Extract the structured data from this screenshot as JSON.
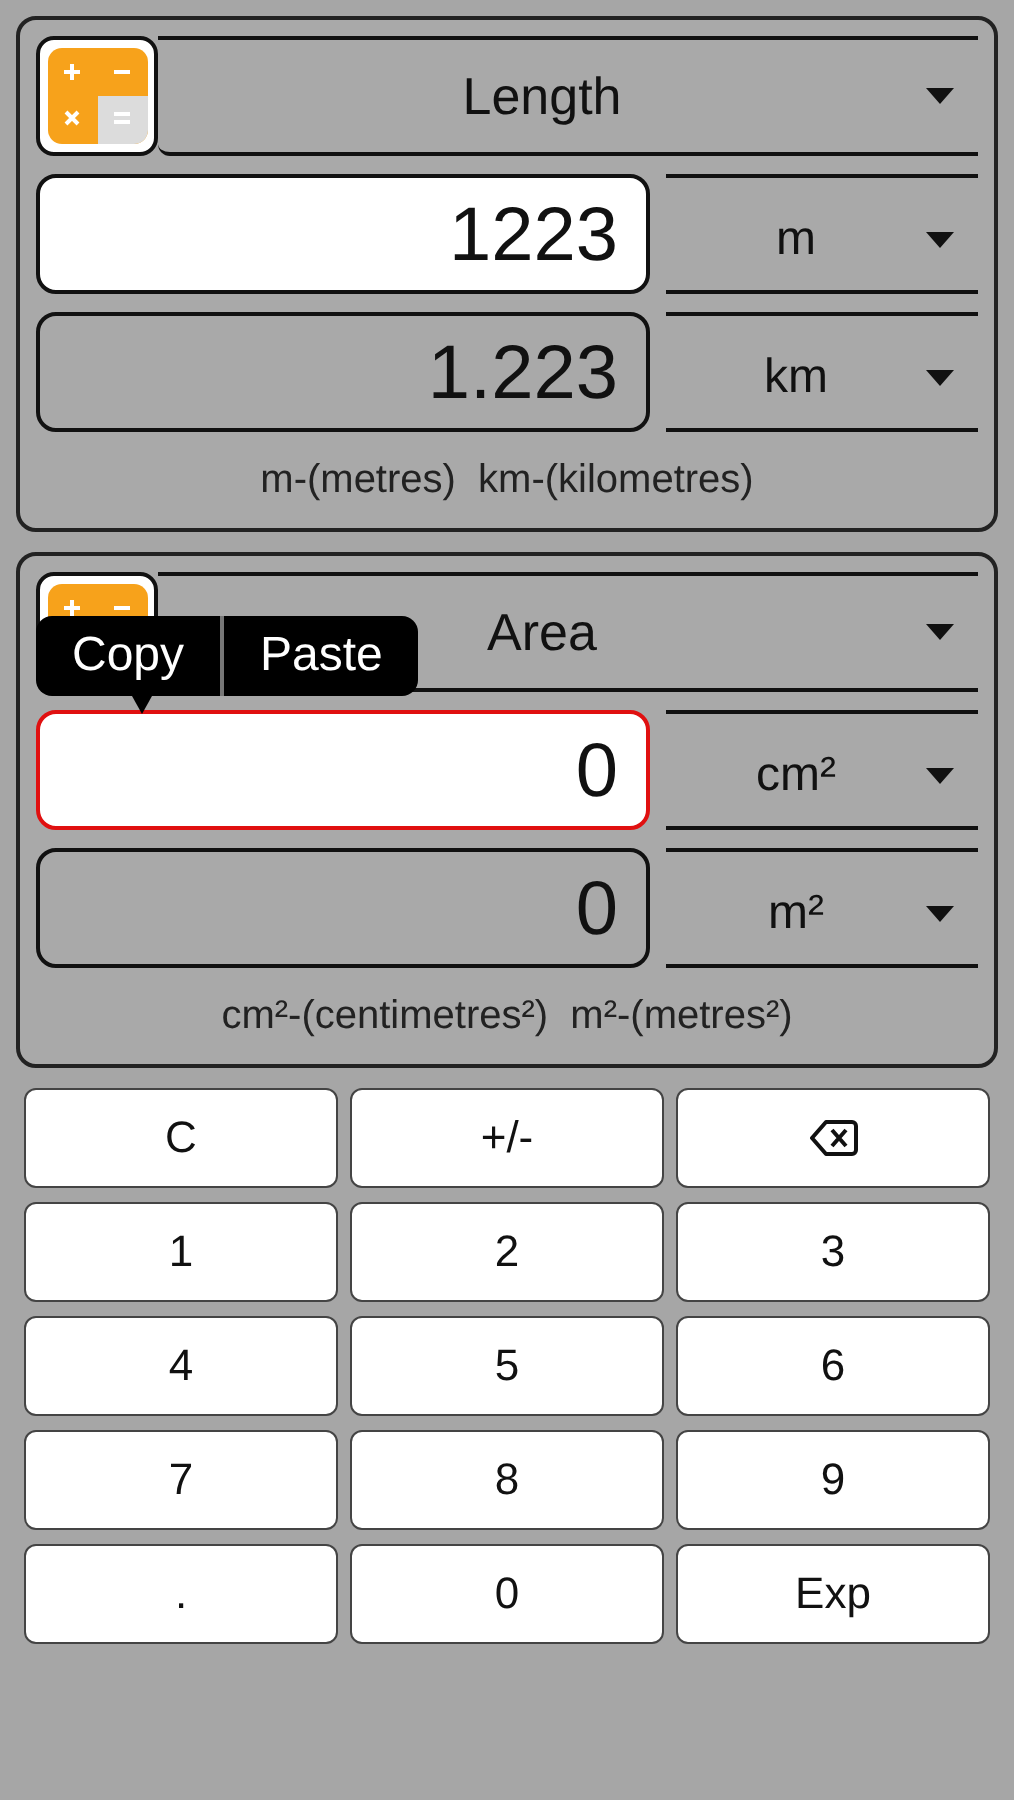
{
  "converters": [
    {
      "category": "Length",
      "input": {
        "value": "1223",
        "focused": false
      },
      "output": {
        "value": "1.223"
      },
      "from_unit": "m",
      "to_unit": "km",
      "legend": "m-(metres)  km-(kilometres)"
    },
    {
      "category": "Area",
      "input": {
        "value": "0",
        "focused": true
      },
      "output": {
        "value": "0"
      },
      "from_unit": "cm²",
      "to_unit": "m²",
      "legend": "cm²-(centimetres²)  m²-(metres²)",
      "edit_menu": [
        "Copy",
        "Paste"
      ]
    }
  ],
  "keypad": [
    {
      "kind": "text",
      "label": "C"
    },
    {
      "kind": "text",
      "label": "+/-"
    },
    {
      "kind": "backspace"
    },
    {
      "kind": "text",
      "label": "1"
    },
    {
      "kind": "text",
      "label": "2"
    },
    {
      "kind": "text",
      "label": "3"
    },
    {
      "kind": "text",
      "label": "4"
    },
    {
      "kind": "text",
      "label": "5"
    },
    {
      "kind": "text",
      "label": "6"
    },
    {
      "kind": "text",
      "label": "7"
    },
    {
      "kind": "text",
      "label": "8"
    },
    {
      "kind": "text",
      "label": "9"
    },
    {
      "kind": "text",
      "label": "."
    },
    {
      "kind": "text",
      "label": "0"
    },
    {
      "kind": "text",
      "label": "Exp"
    }
  ]
}
